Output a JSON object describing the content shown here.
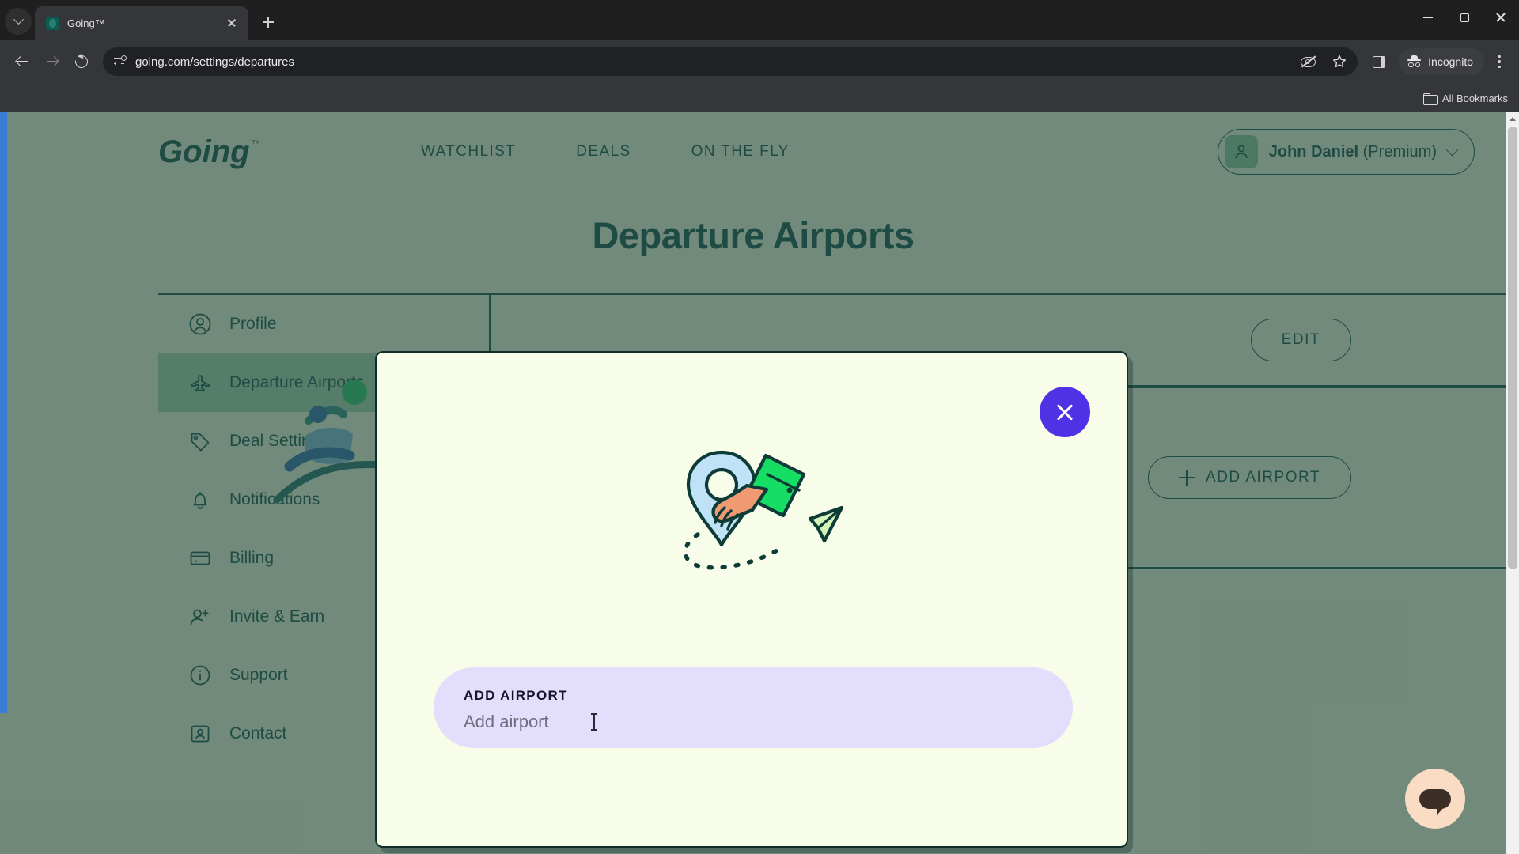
{
  "browser": {
    "tab": {
      "title": "Going™"
    },
    "url": "going.com/settings/departures",
    "profile_badge": "Incognito",
    "bookmarks_label": "All Bookmarks"
  },
  "site": {
    "logo_text": "Going™",
    "nav": [
      {
        "label": "WATCHLIST"
      },
      {
        "label": "DEALS"
      },
      {
        "label": "ON THE FLY"
      }
    ],
    "account": {
      "name": "John Daniel",
      "plan": "(Premium)"
    },
    "page_title": "Departure Airports"
  },
  "sidebar": {
    "items": [
      {
        "label": "Profile",
        "icon": "user-circle-icon",
        "active": false
      },
      {
        "label": "Departure Airports",
        "icon": "airplane-icon",
        "active": true
      },
      {
        "label": "Deal Settings",
        "icon": "tag-icon",
        "active": false
      },
      {
        "label": "Notifications",
        "icon": "bell-icon",
        "active": false
      },
      {
        "label": "Billing",
        "icon": "credit-card-icon",
        "active": false
      },
      {
        "label": "Invite & Earn",
        "icon": "user-plus-icon",
        "active": false
      },
      {
        "label": "Support",
        "icon": "info-circle-icon",
        "active": false
      },
      {
        "label": "Contact",
        "icon": "contact-icon",
        "active": false
      }
    ]
  },
  "content": {
    "edit_button": "EDIT",
    "add_airport_button": "ADD AIRPORT"
  },
  "modal": {
    "close_label": "close-icon",
    "field_label": "ADD AIRPORT",
    "field_placeholder": "Add airport",
    "field_value": ""
  },
  "colors": {
    "brand_teal": "#0f4f47",
    "page_bg": "#e8f3d8",
    "modal_bg": "#f7fde9",
    "close_purple": "#4f32e6",
    "field_lavender": "#e2defb",
    "focus_blue": "#3a7bd5",
    "active_green": "#66b588"
  }
}
